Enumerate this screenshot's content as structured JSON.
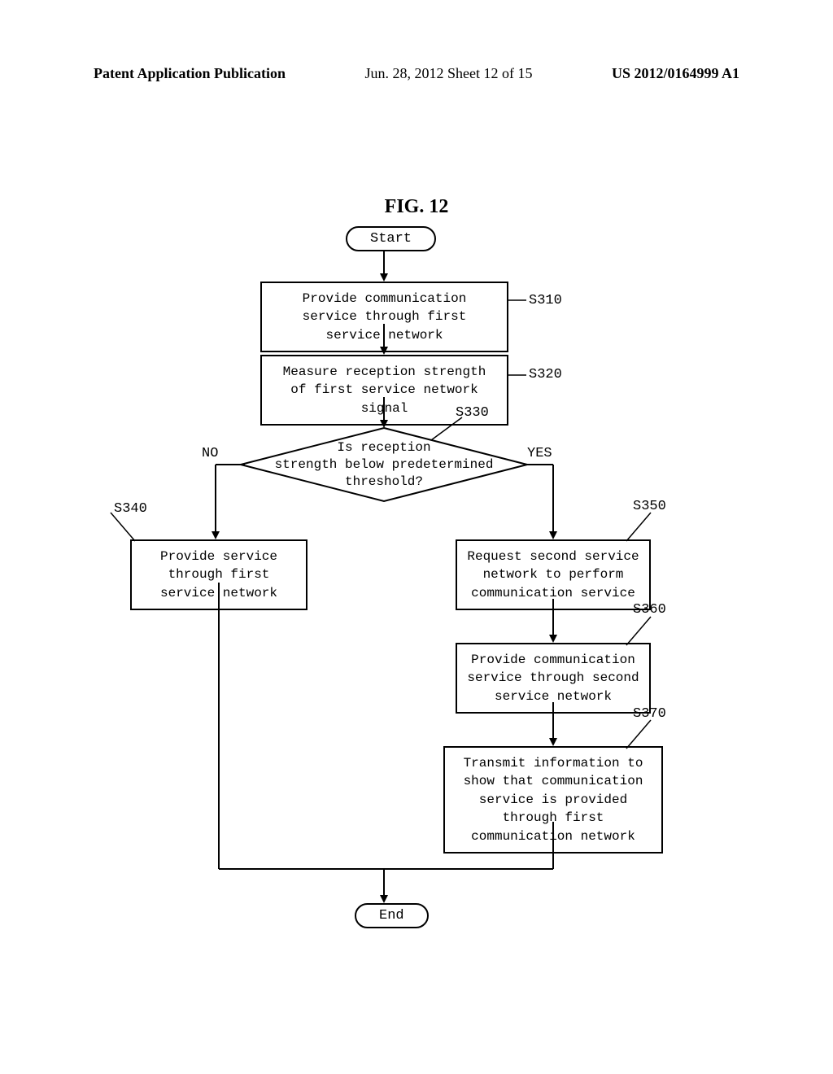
{
  "header": {
    "left": "Patent Application Publication",
    "center": "Jun. 28, 2012  Sheet 12 of 15",
    "right": "US 2012/0164999 A1"
  },
  "figure_title": "FIG. 12",
  "terminals": {
    "start": "Start",
    "end": "End"
  },
  "steps": {
    "s310": "Provide communication service through first service network",
    "s320": "Measure reception strength of first service network signal",
    "s330_line1": "Is reception",
    "s330_line2": "strength below predetermined",
    "s330_line3": "threshold?",
    "s340": "Provide service through first service network",
    "s350": "Request second service network to perform communication service",
    "s360": "Provide communication service through second service network",
    "s370": "Transmit information to show that communication service is provided through first communication network"
  },
  "step_labels": {
    "s310": "S310",
    "s320": "S320",
    "s330": "S330",
    "s340": "S340",
    "s350": "S350",
    "s360": "S360",
    "s370": "S370"
  },
  "branch_labels": {
    "no": "NO",
    "yes": "YES"
  }
}
